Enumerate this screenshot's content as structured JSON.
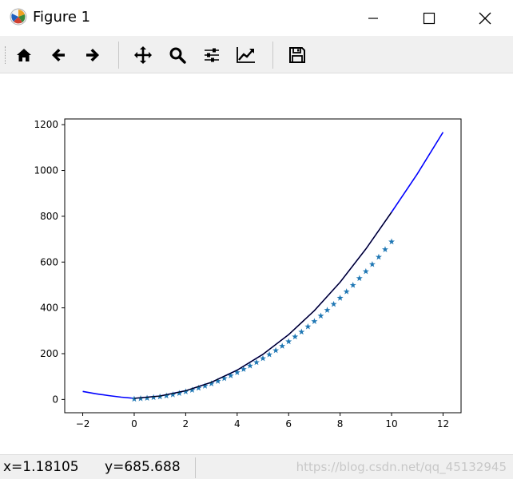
{
  "window": {
    "title": "Figure 1",
    "app_icon": "matplotlib-icon",
    "controls": [
      "minimize-icon",
      "maximize-icon",
      "close-icon"
    ]
  },
  "toolbar": {
    "buttons": [
      {
        "name": "home-button",
        "icon": "home-icon"
      },
      {
        "name": "back-button",
        "icon": "arrow-left-icon"
      },
      {
        "name": "forward-button",
        "icon": "arrow-right-icon"
      },
      {
        "name": "pan-button",
        "icon": "move-icon"
      },
      {
        "name": "zoom-button",
        "icon": "magnifier-icon"
      },
      {
        "name": "configure-subplots-button",
        "icon": "sliders-icon"
      },
      {
        "name": "edit-axis-button",
        "icon": "chart-trend-icon"
      },
      {
        "name": "save-button",
        "icon": "floppy-disk-icon"
      }
    ]
  },
  "status": {
    "coords": "x=1.18105      y=685.688",
    "watermark": "https://blog.csdn.net/qq_45132945"
  },
  "chart_data": {
    "type": "line",
    "title": "",
    "xlabel": "",
    "ylabel": "",
    "xlim": [
      -2.7,
      12.7
    ],
    "ylim": [
      -58,
      1225
    ],
    "xticks": [
      "−2",
      "0",
      "2",
      "4",
      "6",
      "8",
      "10",
      "12"
    ],
    "xtick_values": [
      -2,
      0,
      2,
      4,
      6,
      8,
      10,
      12
    ],
    "yticks": [
      "0",
      "200",
      "400",
      "600",
      "800",
      "1000",
      "1200"
    ],
    "ytick_values": [
      0,
      200,
      400,
      600,
      800,
      1000,
      1200
    ],
    "grid": false,
    "legend": "none",
    "series": [
      {
        "style": "line",
        "color": "#0000ff",
        "x": [
          -2,
          -1.5,
          -1,
          -0.5,
          0,
          1,
          2,
          3,
          4,
          5,
          6,
          7,
          8,
          9,
          10,
          11,
          12
        ],
        "y": [
          35,
          25,
          17,
          10,
          5,
          15,
          38,
          75,
          128,
          197,
          283,
          388,
          512,
          657,
          818,
          985,
          1167
        ]
      },
      {
        "style": "markers",
        "marker": "*",
        "color": "#1f77b4",
        "x": [
          0,
          0.25,
          0.5,
          0.75,
          1,
          1.25,
          1.5,
          1.75,
          2,
          2.25,
          2.5,
          2.75,
          3,
          3.25,
          3.5,
          3.75,
          4,
          4.25,
          4.5,
          4.75,
          5,
          5.25,
          5.5,
          5.75,
          6,
          6.25,
          6.5,
          6.75,
          7,
          7.25,
          7.5,
          7.75,
          8,
          8.25,
          8.5,
          8.75,
          9,
          9.25,
          9.5,
          9.75,
          10
        ],
        "y": [
          2,
          4,
          6,
          9,
          12,
          16,
          21,
          27,
          34,
          41,
          50,
          59,
          69,
          80,
          92,
          104,
          118,
          132,
          147,
          162,
          179,
          196,
          214,
          233,
          253,
          274,
          295,
          318,
          341,
          365,
          390,
          416,
          443,
          471,
          499,
          529,
          559,
          590,
          622,
          655,
          689
        ]
      },
      {
        "style": "line",
        "color": "#000000",
        "x": [
          0,
          1,
          2,
          3,
          4,
          5,
          6,
          7,
          8,
          9,
          10
        ],
        "y": [
          5,
          15,
          38,
          75,
          128,
          197,
          283,
          388,
          512,
          657,
          818
        ]
      }
    ]
  }
}
